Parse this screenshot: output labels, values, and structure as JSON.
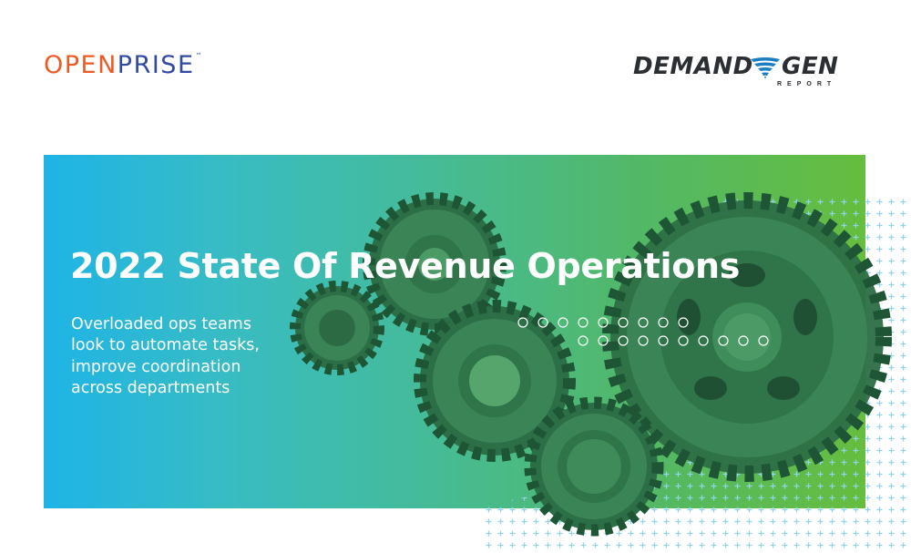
{
  "logos": {
    "openprise": {
      "part1": "OPEN",
      "part2": "PRISE",
      "tm": "™"
    },
    "demandgen": {
      "word1": "DEMAND",
      "word2": "GEN",
      "sub": "REPORT"
    }
  },
  "hero": {
    "title": "2022 State Of Revenue Operations",
    "subtitle_lines": [
      "Overloaded ops teams",
      "look to automate tasks,",
      "improve coordination",
      "across departments"
    ]
  },
  "colors": {
    "openprise_orange": "#ee5a24",
    "openprise_blue": "#2f4aa0",
    "gradient_start": "#1eb4e6",
    "gradient_end": "#66bd3e",
    "gear_green": "#2e7a4a"
  },
  "icons": [
    "gear-icon",
    "swirl-logo-icon"
  ]
}
